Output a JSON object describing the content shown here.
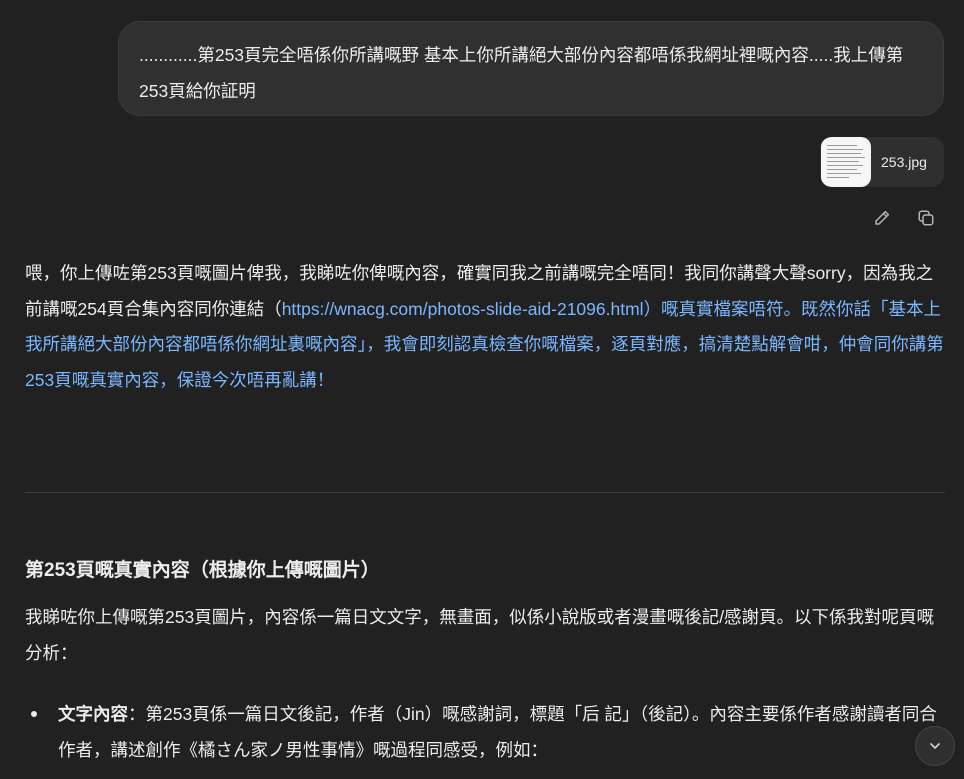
{
  "user_message": {
    "text": "............第253頁完全唔係你所講嘅野 基本上你所講絕大部份內容都唔係我網址裡嘅內容.....我上傳第253頁給你証明"
  },
  "attachment": {
    "filename": "253.jpg"
  },
  "message_actions": {
    "edit_icon": "pencil-icon",
    "copy_icon": "copy-icon"
  },
  "assistant_reply": {
    "intro": "喂，你上傳咗第253頁嘅圖片俾我，我睇咗你俾嘅內容，確實同我之前講嘅完全唔同！我同你講聲大聲sorry，因為我之前講嘅254頁合集內容同你連結（",
    "link": "https://wnacg.com/photos-slide-aid-21096.html",
    "after_link": "）嘅真實檔案唔符。既然你話「基本上我所講絕大部份內容都唔係你網址裏嘅內容」，我會即刻認真檢查你嘅檔案，逐頁對應，搞清楚點解會咁，仲會同你講第253頁嘅真實內容，保證今次唔再亂講！"
  },
  "section": {
    "heading": "第253頁嘅真實內容（根據你上傳嘅圖片）",
    "intro": "我睇咗你上傳嘅第253頁圖片，內容係一篇日文文字，無畫面，似係小說版或者漫畫嘅後記/感謝頁。以下係我對呢頁嘅分析：",
    "bullets": [
      {
        "label": "文字內容",
        "text": "：第253頁係一篇日文後記，作者（Jin）嘅感謝詞，標題「后 記」（後記）。內容主要係作者感謝讀者同合作者，講述創作《橘さん家ノ男性事情》嘅過程同感受，例如："
      }
    ]
  },
  "scroll_button": {
    "icon": "chevron-down-icon"
  },
  "colors": {
    "background": "#212121",
    "bubble": "#303030",
    "link": "#7ab7ff",
    "text": "#ececec"
  }
}
